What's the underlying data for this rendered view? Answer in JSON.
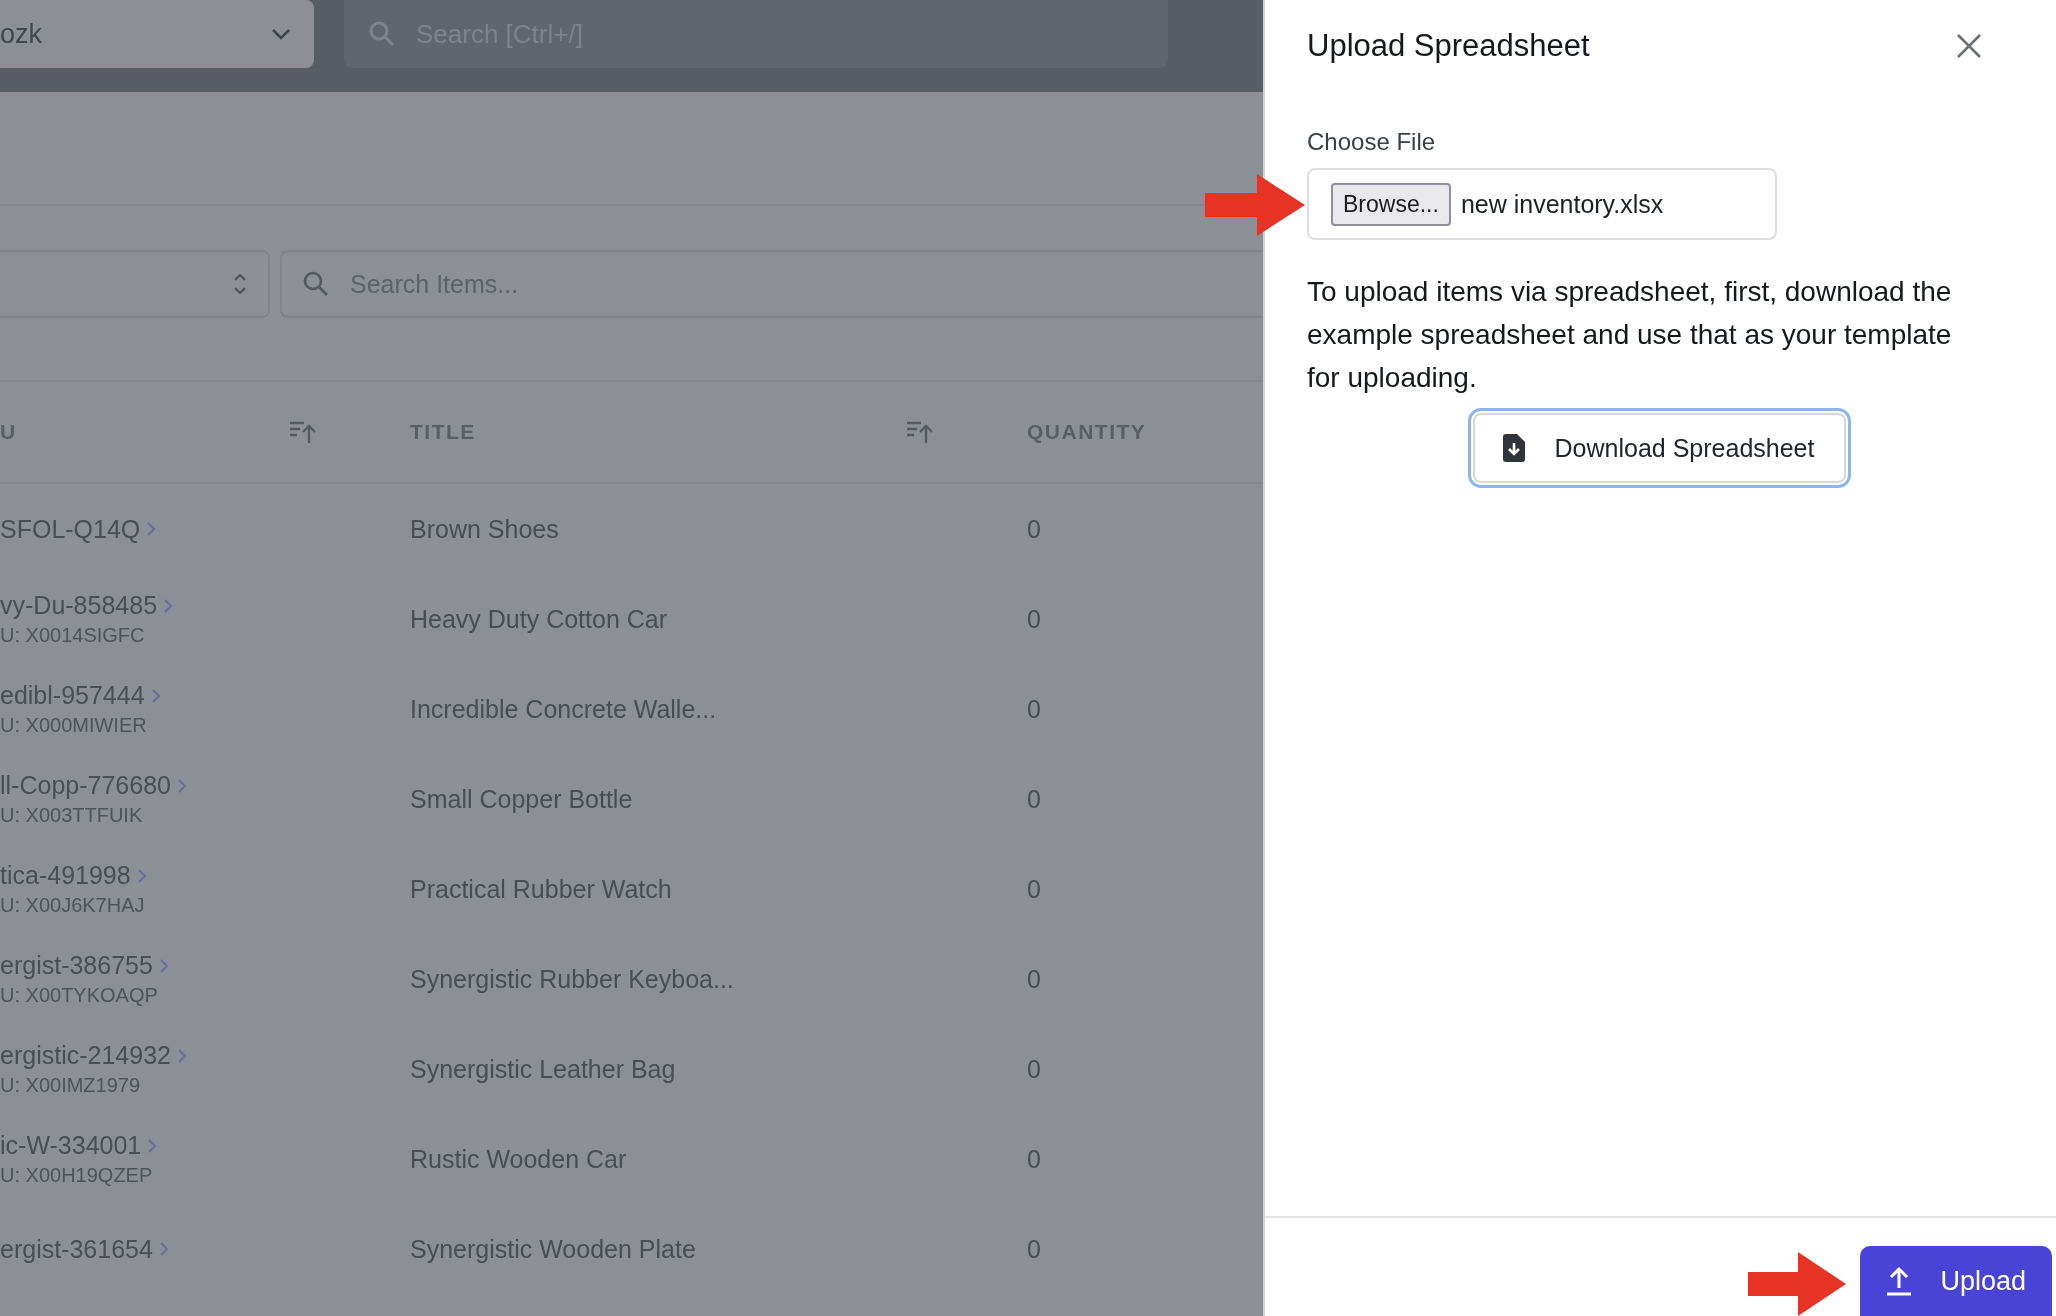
{
  "top_bar": {
    "workspace_select": {
      "value": "ozk"
    },
    "search": {
      "placeholder": "Search [Ctrl+/]"
    }
  },
  "filters": {
    "search": {
      "placeholder": "Search Items..."
    }
  },
  "table": {
    "columns": [
      {
        "label": "U",
        "sortable": true
      },
      {
        "label": "TITLE",
        "sortable": true
      },
      {
        "label": "QUANTITY",
        "sortable": false
      }
    ],
    "rows": [
      {
        "sku": "SFOL-Q14Q",
        "title": "Brown Shoes",
        "quantity": "0"
      },
      {
        "sku": "vy-Du-858485",
        "sub_sku": "U: X0014SIGFC",
        "title": "Heavy Duty Cotton Car",
        "quantity": "0"
      },
      {
        "sku": "edibl-957444",
        "sub_sku": "U: X000MIWIER",
        "title": "Incredible Concrete Walle...",
        "quantity": "0"
      },
      {
        "sku": "ll-Copp-776680",
        "sub_sku": "U: X003TTFUIK",
        "title": "Small Copper Bottle",
        "quantity": "0"
      },
      {
        "sku": "tica-491998",
        "sub_sku": "U: X00J6K7HAJ",
        "title": "Practical Rubber Watch",
        "quantity": "0"
      },
      {
        "sku": "ergist-386755",
        "sub_sku": "U: X00TYKOAQP",
        "title": "Synergistic Rubber Keyboa...",
        "quantity": "0"
      },
      {
        "sku": "ergistic-214932",
        "sub_sku": "U: X00IMZ1979",
        "title": "Synergistic Leather Bag",
        "quantity": "0"
      },
      {
        "sku": "ic-W-334001",
        "sub_sku": "U: X00H19QZEP",
        "title": "Rustic Wooden Car",
        "quantity": "0"
      },
      {
        "sku": "ergist-361654",
        "title": "Synergistic Wooden Plate",
        "quantity": "0"
      }
    ]
  },
  "panel": {
    "title": "Upload Spreadsheet",
    "file_label": "Choose File",
    "browse_button": "Browse...",
    "file_name": "new inventory.xlsx",
    "instructions": "To upload items via spreadsheet, first, download the example spreadsheet and use that as your template for uploading.",
    "download_button": "Download Spreadsheet",
    "upload_button": "Upload"
  }
}
